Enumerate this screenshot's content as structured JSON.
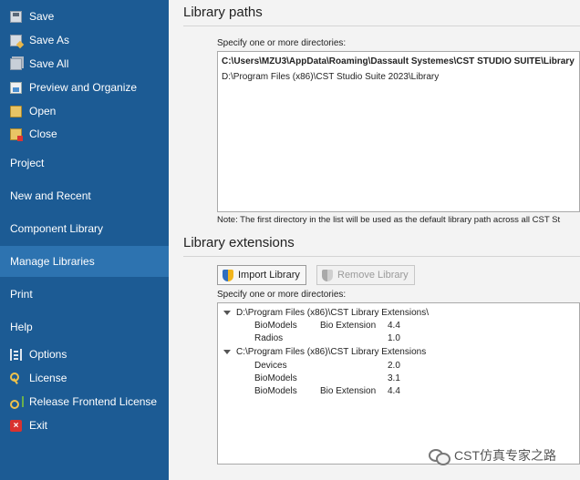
{
  "sidebar": {
    "file_items": [
      {
        "label": "Save",
        "icon": "save-icon"
      },
      {
        "label": "Save As",
        "icon": "save-as-icon"
      },
      {
        "label": "Save All",
        "icon": "save-all-icon"
      },
      {
        "label": "Preview and Organize",
        "icon": "preview-icon"
      },
      {
        "label": "Open",
        "icon": "open-folder-icon"
      },
      {
        "label": "Close",
        "icon": "close-folder-icon"
      }
    ],
    "sections": [
      {
        "label": "Project"
      },
      {
        "label": "New and Recent"
      },
      {
        "label": "Component Library"
      },
      {
        "label": "Manage Libraries"
      },
      {
        "label": "Print"
      },
      {
        "label": "Help"
      }
    ],
    "help_items": [
      {
        "label": "Options",
        "icon": "options-icon"
      },
      {
        "label": "License",
        "icon": "key-icon"
      },
      {
        "label": "Release Frontend License",
        "icon": "release-license-icon"
      },
      {
        "label": "Exit",
        "icon": "exit-icon"
      }
    ],
    "colors": {
      "background": "#1c5b94",
      "active": "#2d73b0"
    }
  },
  "library_paths": {
    "heading": "Library paths",
    "instruction": "Specify one or more directories:",
    "paths": [
      "C:\\Users\\MZU3\\AppData\\Roaming\\Dassault Systemes\\CST STUDIO SUITE\\Library",
      "D:\\Program Files (x86)\\CST Studio Suite 2023\\Library"
    ],
    "note": "Note: The first directory in the list will be used as the default library path across all CST St"
  },
  "library_extensions": {
    "heading": "Library extensions",
    "import_button": "Import Library",
    "remove_button": "Remove Library",
    "instruction": "Specify one or more directories:",
    "groups": [
      {
        "path": "D:\\Program Files (x86)\\CST Library Extensions\\",
        "items": [
          {
            "name": "BioModels",
            "extension": "Bio Extension",
            "version": "4.4"
          },
          {
            "name": "Radios",
            "extension": "",
            "version": "1.0"
          }
        ]
      },
      {
        "path": "C:\\Program Files (x86)\\CST Library Extensions",
        "items": [
          {
            "name": "Devices",
            "extension": "",
            "version": "2.0"
          },
          {
            "name": "BioModels",
            "extension": "",
            "version": "3.1"
          },
          {
            "name": "BioModels",
            "extension": "Bio Extension",
            "version": "4.4"
          }
        ]
      }
    ]
  },
  "watermark": {
    "text": "CST仿真专家之路"
  }
}
